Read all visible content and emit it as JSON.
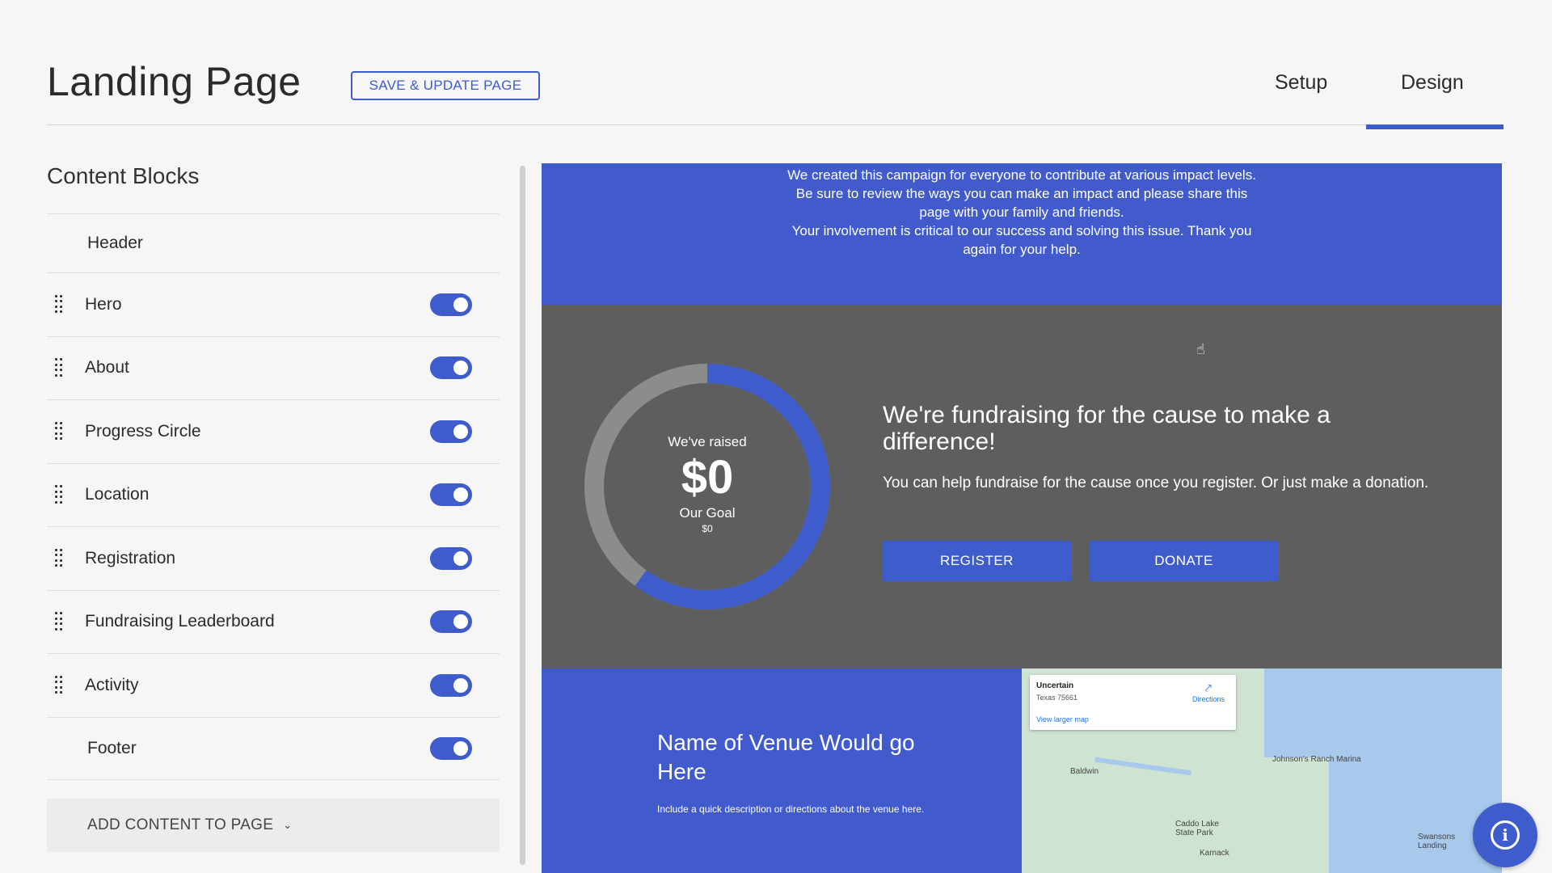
{
  "header": {
    "title": "Landing Page",
    "save_label": "SAVE & UPDATE PAGE",
    "tabs": [
      {
        "label": "Setup"
      },
      {
        "label": "Design"
      }
    ],
    "active_tab": "Design"
  },
  "sidebar": {
    "title": "Content Blocks",
    "items": [
      {
        "label": "Header",
        "draggable": false,
        "toggle": null
      },
      {
        "label": "Hero",
        "draggable": true,
        "toggle": true
      },
      {
        "label": "About",
        "draggable": true,
        "toggle": true
      },
      {
        "label": "Progress Circle",
        "draggable": true,
        "toggle": true
      },
      {
        "label": "Location",
        "draggable": true,
        "toggle": true
      },
      {
        "label": "Registration",
        "draggable": true,
        "toggle": true
      },
      {
        "label": "Fundraising Leaderboard",
        "draggable": true,
        "toggle": true
      },
      {
        "label": "Activity",
        "draggable": true,
        "toggle": true
      },
      {
        "label": "Footer",
        "draggable": false,
        "toggle": true
      }
    ],
    "add_content_label": "ADD CONTENT TO PAGE"
  },
  "preview": {
    "about": {
      "lines": [
        "We created this campaign for everyone to contribute at various impact levels.",
        "Be sure to review the ways you can make an impact and please share this",
        "page with your family and friends.",
        "Your involvement is critical to our success and solving this issue. Thank you",
        "again for your help."
      ]
    },
    "progress": {
      "raised_label": "We've raised",
      "raised_amount": "$0",
      "goal_label": "Our Goal",
      "goal_amount": "$0",
      "ring_fill_fraction": 0.6,
      "heading": "We're fundraising for the cause to make a difference!",
      "description": "You can help fundraise for the cause once you register. Or just make a donation.",
      "register_label": "REGISTER",
      "donate_label": "DONATE"
    },
    "location": {
      "venue_name": "Name of Venue Would go Here",
      "venue_description": "Include a quick description or directions about the venue here.",
      "map": {
        "place_name": "Uncertain",
        "address": "Texas 75661",
        "directions_label": "Directions",
        "larger_map_label": "View larger map",
        "labels": [
          "Baldwin",
          "Johnson's Ranch Marina",
          "Caddo Lake State Park",
          "Karnack",
          "Swansons Landing"
        ]
      }
    }
  },
  "colors": {
    "accent": "#3f5ccc",
    "about_band": "#415bcc",
    "progress_band": "#5e5e5e",
    "ring_track": "#8c8c8c",
    "page_bg": "#f6f6f6"
  },
  "icons": {
    "drag": "drag-handle-icon",
    "chevron": "chevron-down-icon",
    "info": "info-icon",
    "directions": "directions-icon",
    "cursor": "hand-cursor-icon"
  }
}
